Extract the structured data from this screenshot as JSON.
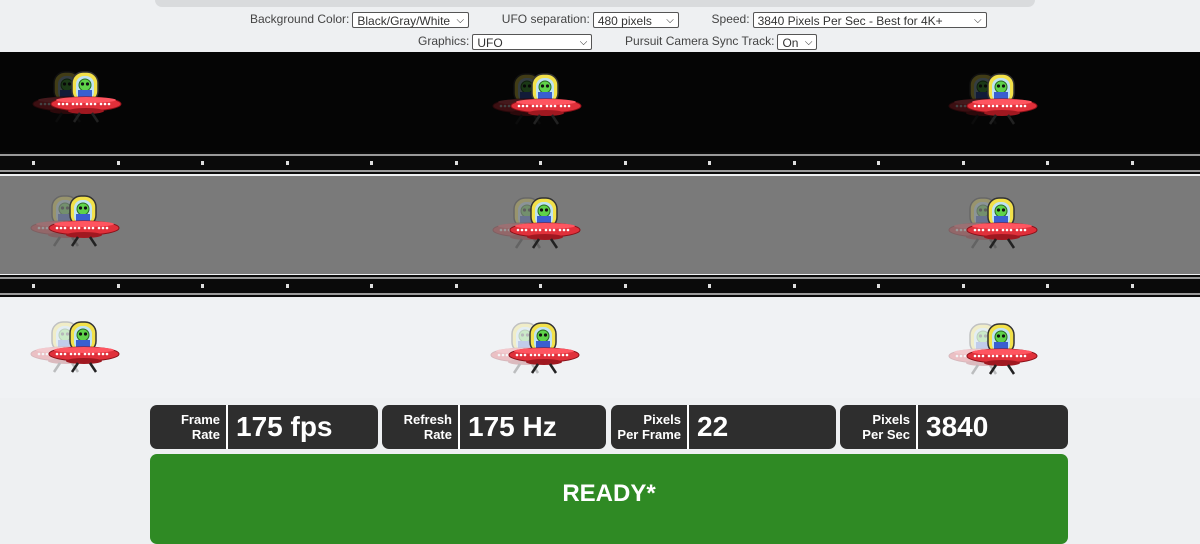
{
  "controls": {
    "background_color": {
      "label": "Background Color:",
      "value": "Black/Gray/White"
    },
    "ufo_separation": {
      "label": "UFO separation:",
      "value": "480 pixels"
    },
    "speed": {
      "label": "Speed:",
      "value": "3840 Pixels Per Sec - Best for 4K+"
    },
    "graphics": {
      "label": "Graphics:",
      "value": "UFO"
    },
    "pursuit_camera": {
      "label": "Pursuit Camera Sync Track:",
      "value": "On"
    }
  },
  "stats": [
    {
      "label_line1": "Frame",
      "label_line2": "Rate",
      "value": "175 fps"
    },
    {
      "label_line1": "Refresh",
      "label_line2": "Rate",
      "value": "175 Hz"
    },
    {
      "label_line1": "Pixels",
      "label_line2": "Per Frame",
      "value": "22"
    },
    {
      "label_line1": "Pixels",
      "label_line2": "Per Sec",
      "value": "3840"
    }
  ],
  "status": "READY*",
  "icons": {
    "ufo": "ufo-alien-icon",
    "select_arrow": "chevron-down-icon"
  },
  "colors": {
    "band_black": "#050505",
    "band_gray": "#7a7a7a",
    "band_white": "#f0f2f4",
    "stat_bg": "#2e2e2e",
    "ready_bg": "#2f8a24"
  }
}
